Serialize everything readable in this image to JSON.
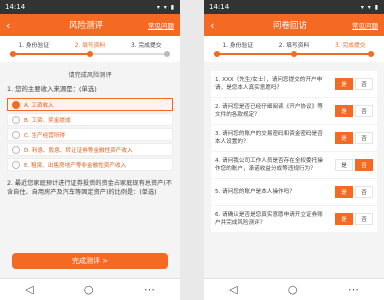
{
  "left": {
    "status": {
      "time": "14:14",
      "icons": "▾ ▾ ▮"
    },
    "title": "风险测评",
    "faq": "常见问题",
    "steps": [
      {
        "label": "1. 身份验证",
        "state": "done"
      },
      {
        "label": "2. 填写资料",
        "state": "active"
      },
      {
        "label": "3. 完成提交",
        "state": "todo"
      }
    ],
    "lead": "请完成风险测评",
    "q1": "1. 您的主要收入来源是：(单选)",
    "options": [
      "A. 工资收入",
      "B. 工资、奖金提成",
      "C. 生产经营所得",
      "D. 利息、股息、转让证券等金融性资产收入",
      "E. 租赁、出售房地产等非金融性资产收入"
    ],
    "selected_index": 0,
    "q2": "2. 最近您家庭预计进行证券投资的资金占家庭现有总资产(不含自住、自用房产及汽车等固定资产)的比例是：(单选)",
    "primary_button": "完成测评 >"
  },
  "right": {
    "status": {
      "time": "14:14",
      "icons": "▾ ▾ ▮"
    },
    "title": "问卷回访",
    "faq": "常见问题",
    "steps": [
      {
        "label": "1. 身份验证",
        "state": "done"
      },
      {
        "label": "2. 填写资料",
        "state": "done"
      },
      {
        "label": "3. 完成提交",
        "state": "active"
      }
    ],
    "questions": [
      {
        "text": "1. XXX（先生/女士），请问您提交的开户申请，是您本人真实意愿吗？",
        "yes": "是",
        "no": "否",
        "selected": "yes"
      },
      {
        "text": "2. 请问您是否已经仔细阅读《开户协议》等文件的各款规定？",
        "yes": "是",
        "no": "否",
        "selected": "yes"
      },
      {
        "text": "3. 请问您的账户的交易密码和资金密码是否本人设置的？",
        "yes": "是",
        "no": "否",
        "selected": "yes"
      },
      {
        "text": "4. 请问我公司工作人员是否存在全权委托操作您的账户，承诺收益分成等违规行为？",
        "yes": "是",
        "no": "否",
        "selected": "no"
      },
      {
        "text": "5. 请问您的账户是本人操作吗？",
        "yes": "是",
        "no": "否",
        "selected": "yes"
      },
      {
        "text": "6. 请确认是否是您真实意愿申请开立证券账户并完成风险测评？",
        "yes": "是",
        "no": "否",
        "selected": "yes"
      }
    ]
  }
}
